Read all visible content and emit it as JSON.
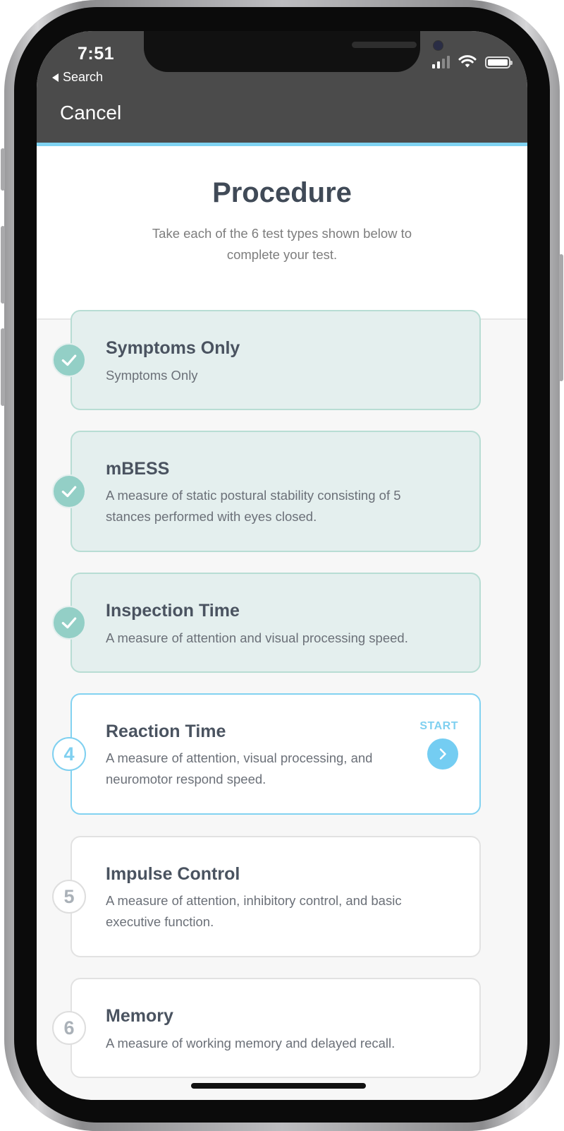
{
  "status_bar": {
    "time": "7:51",
    "back_app": "Search"
  },
  "nav": {
    "cancel_label": "Cancel"
  },
  "header": {
    "title": "Procedure",
    "subtitle": "Take each of the 6 test types shown below to complete your test."
  },
  "colors": {
    "accent": "#7fd3f2",
    "completed_badge": "#93cfc6",
    "title_text": "#404a57"
  },
  "steps": [
    {
      "number": "1",
      "status": "completed",
      "title": "Symptoms Only",
      "description": "Symptoms Only"
    },
    {
      "number": "2",
      "status": "completed",
      "title": "mBESS",
      "description": "A measure of static postural stability consisting of 5 stances performed with eyes closed."
    },
    {
      "number": "3",
      "status": "completed",
      "title": "Inspection Time",
      "description": "A measure of attention and visual processing speed."
    },
    {
      "number": "4",
      "status": "current",
      "title": "Reaction Time",
      "description": "A measure of attention, visual processing, and neuromotor respond speed.",
      "action_label": "START"
    },
    {
      "number": "5",
      "status": "pending",
      "title": "Impulse Control",
      "description": "A measure of attention, inhibitory control, and basic executive function."
    },
    {
      "number": "6",
      "status": "pending",
      "title": "Memory",
      "description": "A measure of working memory and delayed recall."
    }
  ]
}
